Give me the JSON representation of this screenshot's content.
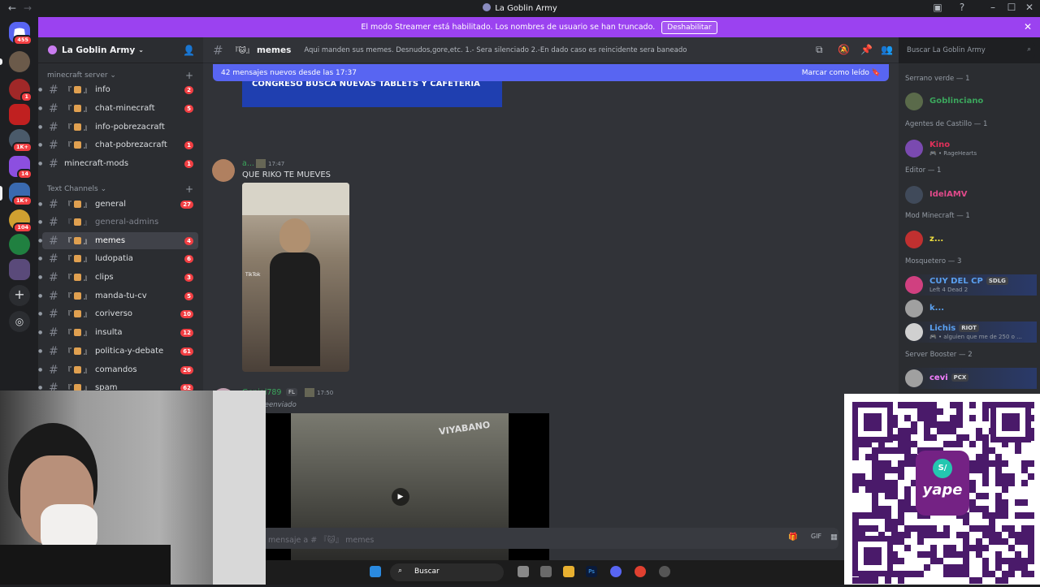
{
  "window": {
    "title": "La Goblin Army",
    "back": "←",
    "forward": "→"
  },
  "banner": {
    "text": "El modo Streamer está habilitado. Los nombres de usuario se han truncado.",
    "button": "Deshabilitar"
  },
  "servers": [
    {
      "badge": "455",
      "color": "#5865f2"
    },
    {
      "badge": "",
      "color": "#6b5a4a"
    },
    {
      "badge": "1",
      "color": "#a02828"
    },
    {
      "badge": "",
      "color": "#c02020"
    },
    {
      "badge": "1K+",
      "color": "#4a5a6a"
    },
    {
      "badge": "14",
      "color": "#8c4fe0"
    },
    {
      "badge": "1K+",
      "color": "#3a6ab0"
    },
    {
      "badge": "104",
      "color": "#d0a030"
    },
    {
      "badge": "",
      "color": "#208040"
    },
    {
      "badge": "",
      "color": "#5a4a7a"
    }
  ],
  "guild": {
    "name": "La Goblin Army"
  },
  "categories": {
    "minecraft": "minecraft server",
    "text": "Text Channels"
  },
  "channels": [
    {
      "name": "info",
      "prefix": "『",
      "count": "2"
    },
    {
      "name": "chat-minecraft",
      "prefix": "『",
      "count": "5"
    },
    {
      "name": "info-pobrezacraft",
      "prefix": "『",
      "count": ""
    },
    {
      "name": "chat-pobrezacraft",
      "prefix": "『",
      "count": "1"
    },
    {
      "name": "minecraft-mods",
      "prefix": "",
      "count": "1"
    },
    {
      "name": "general",
      "prefix": "『",
      "count": "27"
    },
    {
      "name": "general-admins",
      "prefix": "『",
      "count": ""
    },
    {
      "name": "memes",
      "prefix": "『",
      "count": "4"
    },
    {
      "name": "ludopatia",
      "prefix": "『",
      "count": "6"
    },
    {
      "name": "clips",
      "prefix": "『",
      "count": "3"
    },
    {
      "name": "manda-tu-cv",
      "prefix": "『",
      "count": "5"
    },
    {
      "name": "coriverso",
      "prefix": "『",
      "count": "10"
    },
    {
      "name": "insulta",
      "prefix": "『",
      "count": "12"
    },
    {
      "name": "politica-y-debate",
      "prefix": "『",
      "count": "61"
    },
    {
      "name": "comandos",
      "prefix": "『",
      "count": "26"
    },
    {
      "name": "spam",
      "prefix": "『",
      "count": "62"
    }
  ],
  "channel": {
    "prefix": "『🐱』",
    "name": "memes",
    "topic": "Aqui manden sus memes. Desnudos,gore,etc. 1.- Sera silenciado 2.-En dado caso es reincidente sera baneado"
  },
  "search_placeholder": "Buscar La Goblin Army",
  "new_messages": {
    "text": "42 mensajes nuevos desde las 17:37",
    "mark": "Marcar como leído"
  },
  "messages": [
    {
      "image_caption": "CONGRESO BUSCA NUEVAS TABLETS Y CAFETERIA"
    },
    {
      "author": "a...",
      "time": "17:47",
      "text": "QUE RIKO TE MUEVES",
      "watermark": "TikTok"
    },
    {
      "author": "Genial789",
      "tag": "FL",
      "time": "17:50",
      "forwarded": "Reenviado",
      "video_text": "VIYABANO"
    }
  ],
  "composer_placeholder": "mensaje a # 『🐱』 memes",
  "members": [
    {
      "category": "Serrano verde — 1",
      "name": "Goblinciano",
      "color": "#3ba55c",
      "sub": "",
      "avatar": "#5a6a4a"
    },
    {
      "category": "Agentes de Castillo — 1",
      "name": "Kino",
      "color": "#e0305a",
      "sub": "🎮 • RageHearts",
      "avatar": "#7a4ab0"
    },
    {
      "category": "Editor — 1",
      "name": "IdelAMV",
      "color": "#e04a8a",
      "sub": "",
      "avatar": "#404a5a"
    },
    {
      "category": "Mod Minecraft — 1",
      "name": "z...",
      "color": "#f0e040",
      "sub": "",
      "avatar": "#c03030"
    },
    {
      "category": "Mosquetero — 3",
      "name": "CUY DEL CP",
      "color": "#5aa0f0",
      "tag": "SDLG",
      "sub": "Left 4 Dead 2",
      "avatar": "#d04080"
    },
    {
      "category": "",
      "name": "k...",
      "color": "#5aa0f0",
      "sub": "",
      "avatar": "#a0a0a0"
    },
    {
      "category": "",
      "name": "Lichis",
      "color": "#5aa0f0",
      "tag": "RIOT",
      "sub": "🎮 • alguien que me de 250 o ...",
      "avatar": "#d0d0d0"
    },
    {
      "category": "Server Booster — 2",
      "name": "cevi",
      "color": "#f47fff",
      "tag": "PCX",
      "sub": "",
      "avatar": "#a0a0a0"
    }
  ],
  "taskbar": {
    "search": "Buscar"
  },
  "qr": {
    "brand": "yape",
    "symbol": "S/"
  }
}
